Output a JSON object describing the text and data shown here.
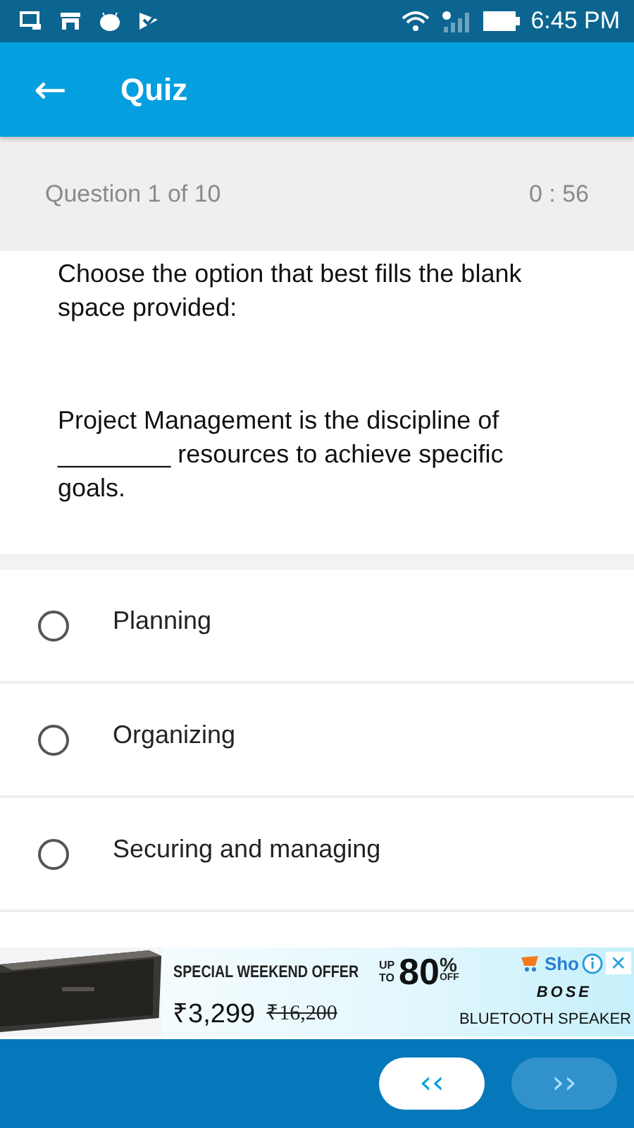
{
  "status_bar": {
    "time": "6:45 PM"
  },
  "app_bar": {
    "back": "←",
    "title": "Quiz"
  },
  "header": {
    "progress": "Question 1 of  10",
    "timer": "0 : 56"
  },
  "question": {
    "instruction": "Choose the option that best fills the blank space provided:",
    "text": "Project Management is the discipline of ________ resources to achieve specific goals."
  },
  "options": [
    {
      "label": "Planning",
      "selected": false
    },
    {
      "label": "Organizing",
      "selected": false
    },
    {
      "label": "Securing and managing",
      "selected": false
    }
  ],
  "ad": {
    "headline": "SPECIAL WEEKEND OFFER",
    "up_to": "UP TO",
    "discount": "80",
    "percent": "%",
    "off": "OFF",
    "price": "₹3,299",
    "old_price": "₹16,200",
    "store": "Sho",
    "brand": "BOSE",
    "product": "BLUETOOTH SPEAKER",
    "close": "✕"
  },
  "nav": [
    {
      "label": "‹‹",
      "disabled": false
    },
    {
      "label": "››",
      "disabled": true
    }
  ]
}
